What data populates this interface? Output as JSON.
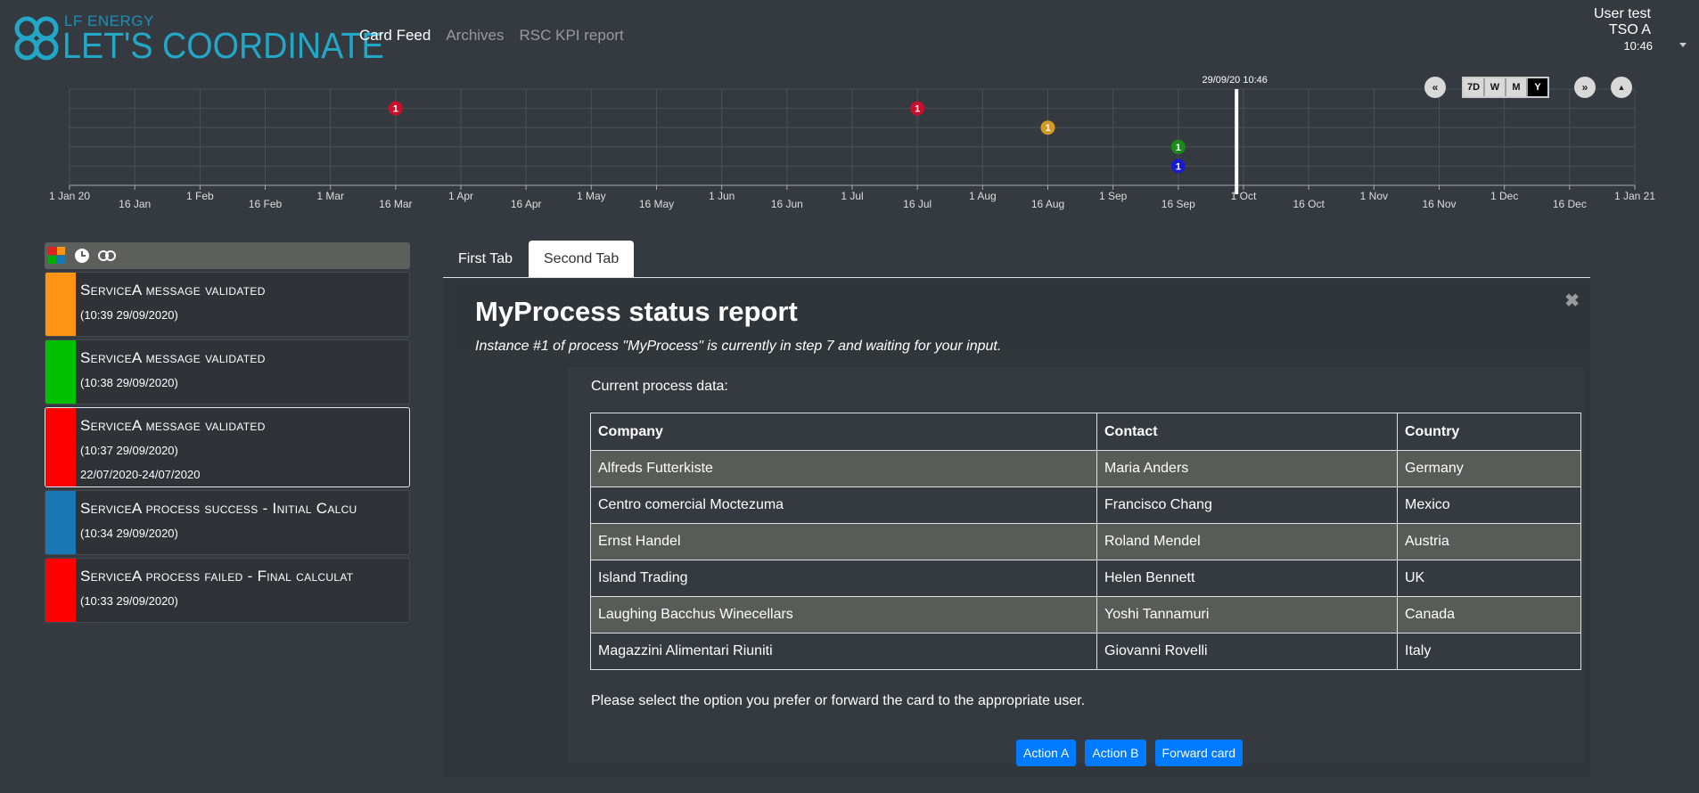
{
  "header": {
    "logo_small": "LF ENERGY",
    "logo_main": "LET'S COORDINATE",
    "nav": [
      {
        "label": "Card Feed",
        "active": true
      },
      {
        "label": "Archives",
        "active": false
      },
      {
        "label": "RSC KPI report",
        "active": false
      }
    ],
    "user_name": "User test",
    "user_entity": "TSO A",
    "clock": "10:46"
  },
  "timeline": {
    "current_marker_label": "29/09/20 10:46",
    "controls": {
      "back": "«",
      "forward": "»",
      "collapse": "▲",
      "ranges": [
        "7D",
        "W",
        "M",
        "Y"
      ],
      "selected": "Y"
    },
    "ticks_top": [
      "1 Jan 20",
      "1 Feb",
      "1 Mar",
      "1 Apr",
      "1 May",
      "1 Jun",
      "1 Jul",
      "1 Aug",
      "1 Sep",
      "1 Oct",
      "1 Nov",
      "1 Dec",
      "1 Jan 21"
    ],
    "ticks_bottom": [
      "16 Jan",
      "16 Feb",
      "16 Mar",
      "16 Apr",
      "16 May",
      "16 Jun",
      "16 Jul",
      "16 Aug",
      "16 Sep",
      "16 Oct",
      "16 Nov",
      "16 Dec"
    ],
    "points": [
      {
        "date": "16 Mar",
        "count": "1",
        "color": "#c8102e",
        "row": 1
      },
      {
        "date": "16 Jul",
        "count": "1",
        "color": "#c8102e",
        "row": 1
      },
      {
        "date": "16 Aug",
        "count": "1",
        "color": "#d39a2a",
        "row": 2
      },
      {
        "date": "16 Sep",
        "count": "1",
        "color": "#1a8a1a",
        "row": 3
      },
      {
        "date": "16 Sep",
        "count": "1",
        "color": "#1a1ad0",
        "row": 4
      }
    ]
  },
  "feed": {
    "cards": [
      {
        "title": "ServiceA message validated",
        "date": "(10:39 29/09/2020)",
        "range": "",
        "color": "#ff9416",
        "selected": false
      },
      {
        "title": "ServiceA message validated",
        "date": "(10:38 29/09/2020)",
        "range": "",
        "color": "#00c000",
        "selected": false
      },
      {
        "title": "ServiceA message validated",
        "date": "(10:37 29/09/2020)",
        "range": "22/07/2020-24/07/2020",
        "color": "#ff0000",
        "selected": true
      },
      {
        "title": "ServiceA process success - Initial Calcu",
        "date": "(10:34 29/09/2020)",
        "range": "",
        "color": "#1b76b4",
        "selected": false
      },
      {
        "title": "ServiceA process failed - Final calculat",
        "date": "(10:33 29/09/2020)",
        "range": "",
        "color": "#ff0000",
        "selected": false
      }
    ]
  },
  "detail": {
    "tabs": [
      "First Tab",
      "Second Tab"
    ],
    "active_tab": "Second Tab",
    "title": "MyProcess status report",
    "subtitle": "Instance #1 of process \"MyProcess\" is currently in step 7 and waiting for your input.",
    "close": "✖",
    "data_label": "Current process data:",
    "table": {
      "headers": [
        "Company",
        "Contact",
        "Country"
      ],
      "rows": [
        [
          "Alfreds Futterkiste",
          "Maria Anders",
          "Germany"
        ],
        [
          "Centro comercial Moctezuma",
          "Francisco Chang",
          "Mexico"
        ],
        [
          "Ernst Handel",
          "Roland Mendel",
          "Austria"
        ],
        [
          "Island Trading",
          "Helen Bennett",
          "UK"
        ],
        [
          "Laughing Bacchus Winecellars",
          "Yoshi Tannamuri",
          "Canada"
        ],
        [
          "Magazzini Alimentari Riuniti",
          "Giovanni Rovelli",
          "Italy"
        ]
      ]
    },
    "prompt": "Please select the option you prefer or forward the card to the appropriate user.",
    "actions": [
      "Action A",
      "Action B",
      "Forward card"
    ]
  }
}
